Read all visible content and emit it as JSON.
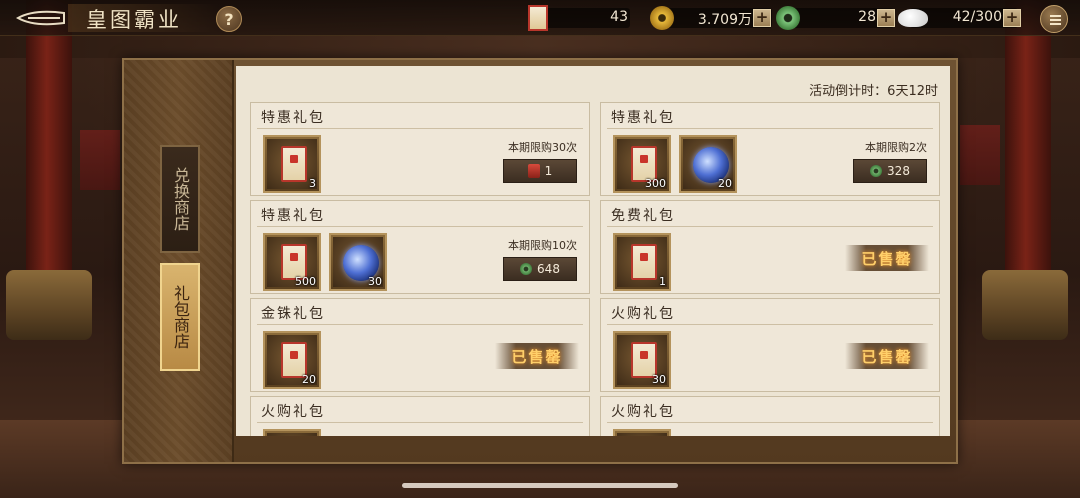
{
  "header": {
    "title": "皇图霸业",
    "help_label": "?",
    "resources": [
      {
        "name": "gift-ticket",
        "value": "43",
        "has_plus": false
      },
      {
        "name": "copper-coin",
        "value": "3.709万",
        "has_plus": true
      },
      {
        "name": "jade",
        "value": "28",
        "has_plus": true
      },
      {
        "name": "silk",
        "value": "42/300",
        "has_plus": true
      }
    ],
    "plus_label": "+"
  },
  "sidebar": {
    "tabs": [
      {
        "label": "兑换商店",
        "active": false
      },
      {
        "label": "礼包商店",
        "active": true
      }
    ]
  },
  "shop": {
    "countdown": "活动倒计时：6天12时",
    "cards": [
      {
        "title": "特惠礼包",
        "items": [
          {
            "icon": "red-envelope-icon",
            "count": "3"
          }
        ],
        "limit": "本期限购30次",
        "price": "1",
        "currency": "red-ticket-icon",
        "sold": false
      },
      {
        "title": "特惠礼包",
        "items": [
          {
            "icon": "red-envelope-icon",
            "count": "300"
          },
          {
            "icon": "blue-orb-icon",
            "count": "20"
          }
        ],
        "limit": "本期限购2次",
        "price": "328",
        "currency": "jade-coin-icon",
        "sold": false
      },
      {
        "title": "特惠礼包",
        "items": [
          {
            "icon": "red-envelope-icon",
            "count": "500"
          },
          {
            "icon": "blue-orb-icon",
            "count": "30"
          }
        ],
        "limit": "本期限购10次",
        "price": "648",
        "currency": "jade-coin-icon",
        "sold": false
      },
      {
        "title": "免费礼包",
        "items": [
          {
            "icon": "red-envelope-icon",
            "count": "1"
          }
        ],
        "sold": true,
        "sold_label": "已售罄"
      },
      {
        "title": "金铢礼包",
        "items": [
          {
            "icon": "red-envelope-icon",
            "count": "20"
          }
        ],
        "sold": true,
        "sold_label": "已售罄"
      },
      {
        "title": "火购礼包",
        "items": [
          {
            "icon": "red-envelope-icon",
            "count": "30"
          }
        ],
        "sold": true,
        "sold_label": "已售罄"
      },
      {
        "title": "火购礼包",
        "items": [],
        "sold": false
      },
      {
        "title": "火购礼包",
        "items": [],
        "sold": false
      }
    ]
  },
  "colors": {
    "panel_bg": "#ece4d3",
    "tab_active": "#d9b46e",
    "sold_text": "#ffcf6a"
  }
}
